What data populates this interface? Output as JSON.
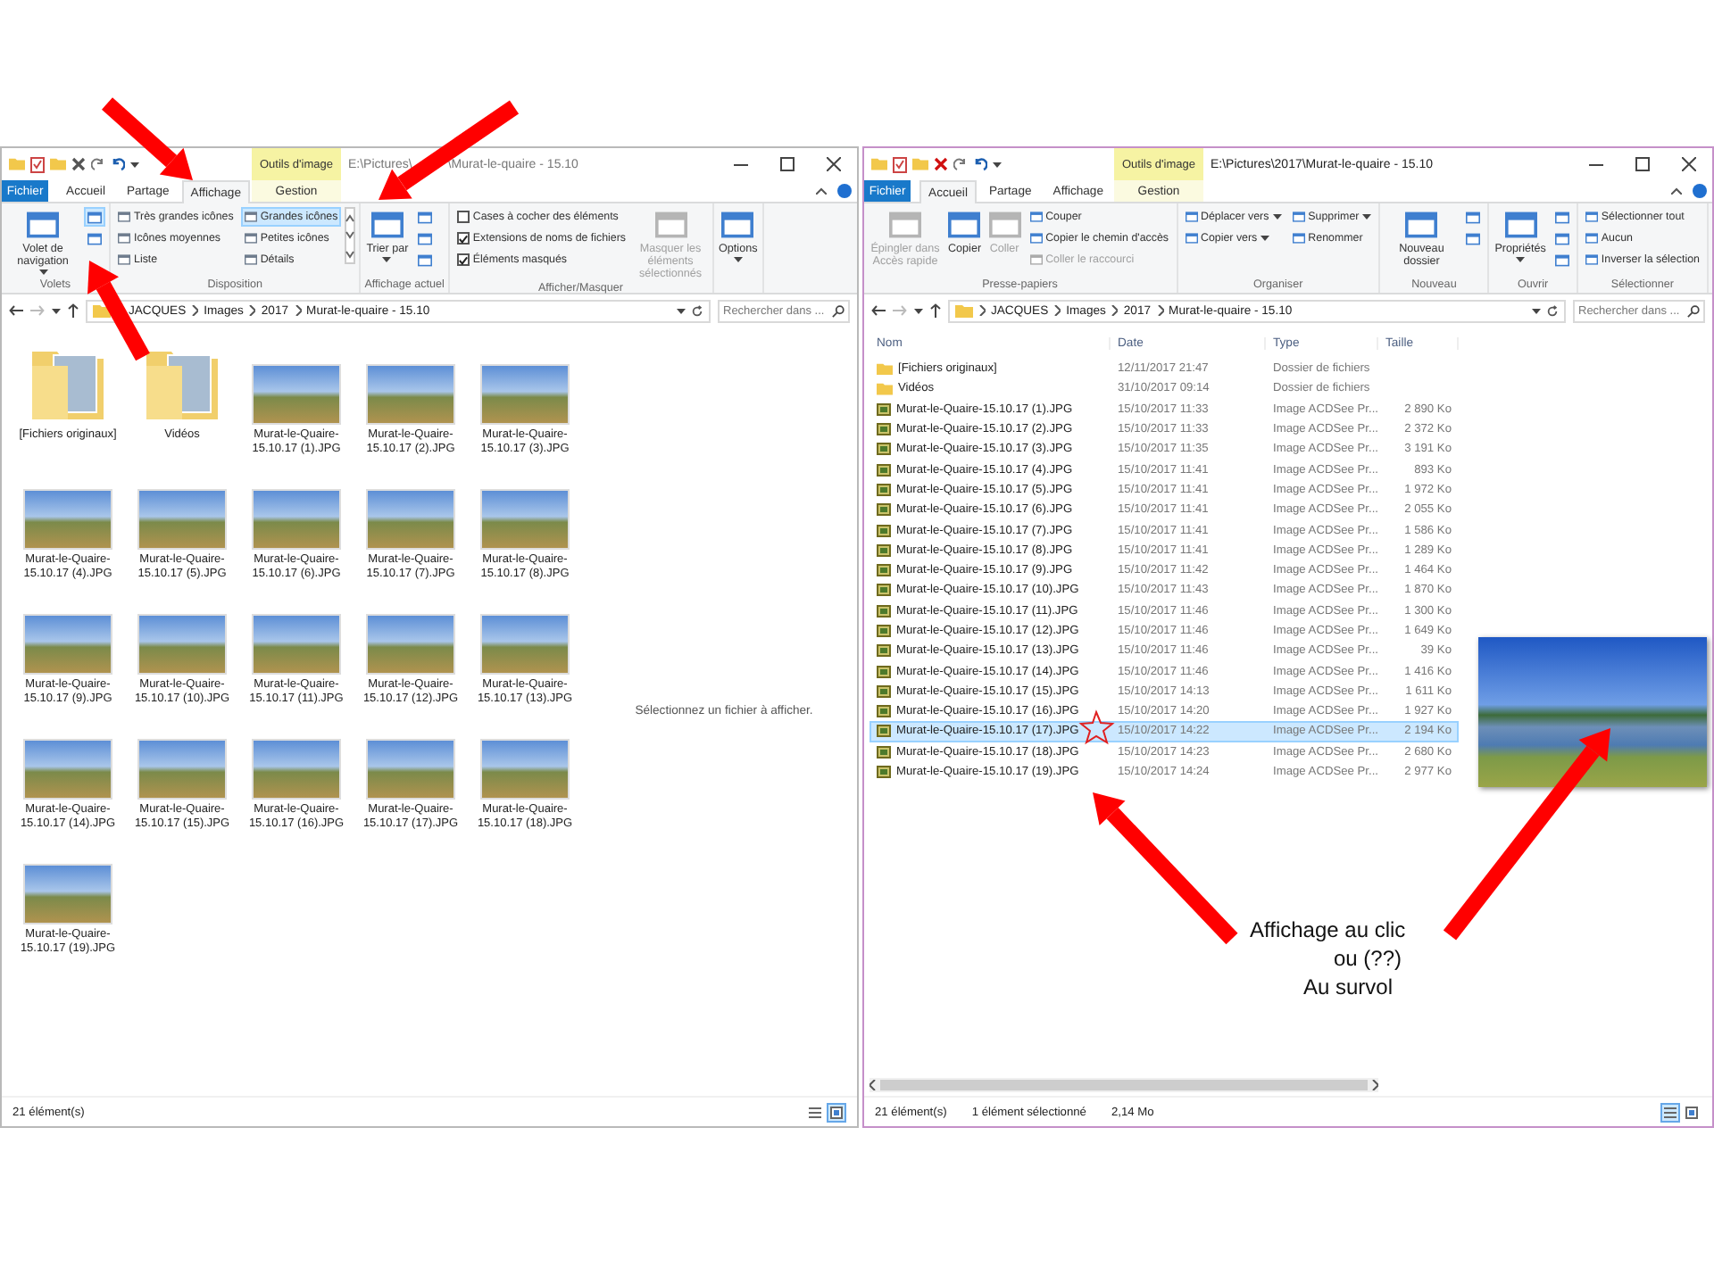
{
  "windows": [
    {
      "active": false,
      "title_bar": {
        "context_label": "Outils d'image",
        "path_parts": [
          "E:\\Pictures\\",
          "\\Murat-le-quaire - 15.10"
        ]
      },
      "tabs": [
        {
          "label": "Fichier",
          "kind": "file",
          "selected": false
        },
        {
          "label": "Accueil",
          "kind": "normal",
          "selected": false
        },
        {
          "label": "Partage",
          "kind": "normal",
          "selected": false
        },
        {
          "label": "Affichage",
          "kind": "normal",
          "selected": true
        },
        {
          "label": "Gestion",
          "kind": "context",
          "selected": false
        }
      ],
      "ribbon": [
        {
          "label": "Volets",
          "items": [
            {
              "kind": "large",
              "label": "Volet de navigation",
              "caret": true,
              "disabled": false
            },
            {
              "kind": "stack",
              "rows": [
                {
                  "kind": "icon",
                  "selected": true
                },
                {
                  "kind": "icon",
                  "selected": false
                }
              ]
            }
          ]
        },
        {
          "label": "Disposition",
          "items": [
            {
              "kind": "stack",
              "rows": [
                {
                  "kind": "option",
                  "label": "Très grandes icônes",
                  "selected": false
                },
                {
                  "kind": "option",
                  "label": "Icônes moyennes",
                  "selected": false
                },
                {
                  "kind": "option",
                  "label": "Liste",
                  "selected": false
                }
              ]
            },
            {
              "kind": "stack",
              "rows": [
                {
                  "kind": "option",
                  "label": "Grandes icônes",
                  "selected": true
                },
                {
                  "kind": "option",
                  "label": "Petites icônes",
                  "selected": false
                },
                {
                  "kind": "option",
                  "label": "Détails",
                  "selected": false
                }
              ]
            },
            {
              "kind": "scroll"
            }
          ]
        },
        {
          "label": "Affichage actuel",
          "items": [
            {
              "kind": "large",
              "label": "Trier par",
              "caret": true,
              "disabled": false
            },
            {
              "kind": "stack",
              "rows": [
                {
                  "kind": "icon",
                  "selected": false
                },
                {
                  "kind": "icon",
                  "selected": false
                },
                {
                  "kind": "icon",
                  "selected": false
                }
              ]
            }
          ]
        },
        {
          "label": "Afficher/Masquer",
          "items": [
            {
              "kind": "stack",
              "rows": [
                {
                  "kind": "check",
                  "label": "Cases à cocher des éléments",
                  "checked": false
                },
                {
                  "kind": "check",
                  "label": "Extensions de noms de fichiers",
                  "checked": true
                },
                {
                  "kind": "check",
                  "label": "Éléments masqués",
                  "checked": true
                }
              ]
            },
            {
              "kind": "large",
              "label": "Masquer les éléments sélectionnés",
              "caret": false,
              "disabled": true
            }
          ]
        },
        {
          "items": [
            {
              "kind": "large",
              "label": "Options",
              "caret": true,
              "disabled": false
            }
          ]
        }
      ],
      "address": {
        "crumbs": [
          "JACQUES",
          "Images",
          "2017",
          "Murat-le-quaire - 15.10"
        ],
        "search": {
          "placeholder": "Rechercher dans ..."
        }
      },
      "body": {
        "kind": "icons",
        "items": [
          {
            "kind": "folder",
            "name": "[Fichiers originaux]"
          },
          {
            "kind": "folder",
            "name": "Vidéos"
          },
          {
            "kind": "photo",
            "name": "Murat-le-Quaire-15.10.17 (1).JPG"
          },
          {
            "kind": "photo",
            "name": "Murat-le-Quaire-15.10.17 (2).JPG"
          },
          {
            "kind": "photo",
            "name": "Murat-le-Quaire-15.10.17 (3).JPG"
          },
          {
            "kind": "photo",
            "name": "Murat-le-Quaire-15.10.17 (4).JPG"
          },
          {
            "kind": "photo",
            "name": "Murat-le-Quaire-15.10.17 (5).JPG"
          },
          {
            "kind": "photo",
            "name": "Murat-le-Quaire-15.10.17 (6).JPG"
          },
          {
            "kind": "photo",
            "name": "Murat-le-Quaire-15.10.17 (7).JPG"
          },
          {
            "kind": "photo",
            "name": "Murat-le-Quaire-15.10.17 (8).JPG"
          },
          {
            "kind": "photo",
            "name": "Murat-le-Quaire-15.10.17 (9).JPG"
          },
          {
            "kind": "photo",
            "name": "Murat-le-Quaire-15.10.17 (10).JPG"
          },
          {
            "kind": "photo",
            "name": "Murat-le-Quaire-15.10.17 (11).JPG"
          },
          {
            "kind": "photo",
            "name": "Murat-le-Quaire-15.10.17 (12).JPG"
          },
          {
            "kind": "photo",
            "name": "Murat-le-Quaire-15.10.17 (13).JPG"
          },
          {
            "kind": "photo",
            "name": "Murat-le-Quaire-15.10.17 (14).JPG"
          },
          {
            "kind": "photo",
            "name": "Murat-le-Quaire-15.10.17 (15).JPG"
          },
          {
            "kind": "photo",
            "name": "Murat-le-Quaire-15.10.17 (16).JPG"
          },
          {
            "kind": "photo",
            "name": "Murat-le-Quaire-15.10.17 (17).JPG"
          },
          {
            "kind": "photo",
            "name": "Murat-le-Quaire-15.10.17 (18).JPG"
          },
          {
            "kind": "photo",
            "name": "Murat-le-Quaire-15.10.17 (19).JPG"
          }
        ],
        "preview": {
          "kind": "message",
          "text": "Sélectionnez un fichier à afficher."
        }
      },
      "status": {
        "count": "21 élément(s)",
        "views": [
          {
            "selected": false
          },
          {
            "selected": true
          }
        ]
      }
    },
    {
      "active": true,
      "title_bar": {
        "context_label": "Outils d'image",
        "path_parts": [
          "E:\\Pictures\\2017\\Murat-le-quaire - 15.10"
        ]
      },
      "tabs": [
        {
          "label": "Fichier",
          "kind": "file",
          "selected": false
        },
        {
          "label": "Accueil",
          "kind": "normal",
          "selected": true
        },
        {
          "label": "Partage",
          "kind": "normal",
          "selected": false
        },
        {
          "label": "Affichage",
          "kind": "normal",
          "selected": false
        },
        {
          "label": "Gestion",
          "kind": "context",
          "selected": false
        }
      ],
      "ribbon": [
        {
          "label": "Presse-papiers",
          "items": [
            {
              "kind": "large",
              "label": "Épingler dans Accès rapide",
              "caret": false,
              "disabled": true
            },
            {
              "kind": "large",
              "label": "Copier",
              "caret": false,
              "disabled": false
            },
            {
              "kind": "large",
              "label": "Coller",
              "caret": false,
              "disabled": true
            },
            {
              "kind": "stack",
              "rows": [
                {
                  "kind": "command",
                  "label": "Couper",
                  "caret": false,
                  "disabled": false
                },
                {
                  "kind": "command",
                  "label": "Copier le chemin d'accès",
                  "caret": false,
                  "disabled": false
                },
                {
                  "kind": "command",
                  "label": "Coller le raccourci",
                  "caret": false,
                  "disabled": true
                }
              ]
            }
          ]
        },
        {
          "label": "Organiser",
          "items": [
            {
              "kind": "stack",
              "rows": [
                {
                  "kind": "command",
                  "label": "Déplacer vers",
                  "caret": true,
                  "disabled": false
                },
                {
                  "kind": "command",
                  "label": "Copier vers",
                  "caret": true,
                  "disabled": false
                }
              ]
            },
            {
              "kind": "stack",
              "rows": [
                {
                  "kind": "command",
                  "label": "Supprimer",
                  "caret": true,
                  "disabled": false
                },
                {
                  "kind": "command",
                  "label": "Renommer",
                  "caret": false,
                  "disabled": false
                }
              ]
            }
          ]
        },
        {
          "label": "Nouveau",
          "items": [
            {
              "kind": "large",
              "label": "Nouveau dossier",
              "caret": false,
              "disabled": false
            },
            {
              "kind": "stack",
              "rows": [
                {
                  "kind": "icon",
                  "selected": false
                },
                {
                  "kind": "icon",
                  "selected": false
                }
              ]
            }
          ]
        },
        {
          "label": "Ouvrir",
          "items": [
            {
              "kind": "large",
              "label": "Propriétés",
              "caret": true,
              "disabled": false
            },
            {
              "kind": "stack",
              "rows": [
                {
                  "kind": "icon",
                  "selected": false
                },
                {
                  "kind": "icon",
                  "selected": false
                },
                {
                  "kind": "icon",
                  "selected": false
                }
              ]
            }
          ]
        },
        {
          "label": "Sélectionner",
          "items": [
            {
              "kind": "stack",
              "rows": [
                {
                  "kind": "command",
                  "label": "Sélectionner tout",
                  "caret": false,
                  "disabled": false
                },
                {
                  "kind": "command",
                  "label": "Aucun",
                  "caret": false,
                  "disabled": false
                },
                {
                  "kind": "command",
                  "label": "Inverser la sélection",
                  "caret": false,
                  "disabled": false
                }
              ]
            }
          ]
        }
      ],
      "address": {
        "crumbs": [
          "JACQUES",
          "Images",
          "2017",
          "Murat-le-quaire - 15.10"
        ],
        "search": {
          "placeholder": "Rechercher dans ..."
        }
      },
      "body": {
        "kind": "details",
        "columns": [
          "Nom",
          "Date",
          "Type",
          "Taille"
        ],
        "rows": [
          {
            "kind": "folder",
            "name": "[Fichiers originaux]",
            "date": "12/11/2017 21:47",
            "type": "Dossier de fichiers",
            "size": "",
            "selected": false
          },
          {
            "kind": "folder",
            "name": "Vidéos",
            "date": "31/10/2017 09:14",
            "type": "Dossier de fichiers",
            "size": "",
            "selected": false
          },
          {
            "kind": "photo",
            "name": "Murat-le-Quaire-15.10.17 (1).JPG",
            "date": "15/10/2017 11:33",
            "type": "Image ACDSee Pr...",
            "size": "2 890 Ko",
            "selected": false
          },
          {
            "kind": "photo",
            "name": "Murat-le-Quaire-15.10.17 (2).JPG",
            "date": "15/10/2017 11:33",
            "type": "Image ACDSee Pr...",
            "size": "2 372 Ko",
            "selected": false
          },
          {
            "kind": "photo",
            "name": "Murat-le-Quaire-15.10.17 (3).JPG",
            "date": "15/10/2017 11:35",
            "type": "Image ACDSee Pr...",
            "size": "3 191 Ko",
            "selected": false
          },
          {
            "kind": "photo",
            "name": "Murat-le-Quaire-15.10.17 (4).JPG",
            "date": "15/10/2017 11:41",
            "type": "Image ACDSee Pr...",
            "size": "893 Ko",
            "selected": false
          },
          {
            "kind": "photo",
            "name": "Murat-le-Quaire-15.10.17 (5).JPG",
            "date": "15/10/2017 11:41",
            "type": "Image ACDSee Pr...",
            "size": "1 972 Ko",
            "selected": false
          },
          {
            "kind": "photo",
            "name": "Murat-le-Quaire-15.10.17 (6).JPG",
            "date": "15/10/2017 11:41",
            "type": "Image ACDSee Pr...",
            "size": "2 055 Ko",
            "selected": false
          },
          {
            "kind": "photo",
            "name": "Murat-le-Quaire-15.10.17 (7).JPG",
            "date": "15/10/2017 11:41",
            "type": "Image ACDSee Pr...",
            "size": "1 586 Ko",
            "selected": false
          },
          {
            "kind": "photo",
            "name": "Murat-le-Quaire-15.10.17 (8).JPG",
            "date": "15/10/2017 11:41",
            "type": "Image ACDSee Pr...",
            "size": "1 289 Ko",
            "selected": false
          },
          {
            "kind": "photo",
            "name": "Murat-le-Quaire-15.10.17 (9).JPG",
            "date": "15/10/2017 11:42",
            "type": "Image ACDSee Pr...",
            "size": "1 464 Ko",
            "selected": false
          },
          {
            "kind": "photo",
            "name": "Murat-le-Quaire-15.10.17 (10).JPG",
            "date": "15/10/2017 11:43",
            "type": "Image ACDSee Pr...",
            "size": "1 870 Ko",
            "selected": false
          },
          {
            "kind": "photo",
            "name": "Murat-le-Quaire-15.10.17 (11).JPG",
            "date": "15/10/2017 11:46",
            "type": "Image ACDSee Pr...",
            "size": "1 300 Ko",
            "selected": false
          },
          {
            "kind": "photo",
            "name": "Murat-le-Quaire-15.10.17 (12).JPG",
            "date": "15/10/2017 11:46",
            "type": "Image ACDSee Pr...",
            "size": "1 649 Ko",
            "selected": false
          },
          {
            "kind": "photo",
            "name": "Murat-le-Quaire-15.10.17 (13).JPG",
            "date": "15/10/2017 11:46",
            "type": "Image ACDSee Pr...",
            "size": "39 Ko",
            "selected": false
          },
          {
            "kind": "photo",
            "name": "Murat-le-Quaire-15.10.17 (14).JPG",
            "date": "15/10/2017 11:46",
            "type": "Image ACDSee Pr...",
            "size": "1 416 Ko",
            "selected": false
          },
          {
            "kind": "photo",
            "name": "Murat-le-Quaire-15.10.17 (15).JPG",
            "date": "15/10/2017 14:13",
            "type": "Image ACDSee Pr...",
            "size": "1 611 Ko",
            "selected": false
          },
          {
            "kind": "photo",
            "name": "Murat-le-Quaire-15.10.17 (16).JPG",
            "date": "15/10/2017 14:20",
            "type": "Image ACDSee Pr...",
            "size": "1 927 Ko",
            "selected": false
          },
          {
            "kind": "photo",
            "name": "Murat-le-Quaire-15.10.17 (17).JPG",
            "date": "15/10/2017 14:22",
            "type": "Image ACDSee Pr...",
            "size": "2 194 Ko",
            "selected": true
          },
          {
            "kind": "photo",
            "name": "Murat-le-Quaire-15.10.17 (18).JPG",
            "date": "15/10/2017 14:23",
            "type": "Image ACDSee Pr...",
            "size": "2 680 Ko",
            "selected": false
          },
          {
            "kind": "photo",
            "name": "Murat-le-Quaire-15.10.17 (19).JPG",
            "date": "15/10/2017 14:24",
            "type": "Image ACDSee Pr...",
            "size": "2 977 Ko",
            "selected": false
          }
        ],
        "preview": {
          "kind": "image"
        }
      },
      "status": {
        "count": "21 élément(s)",
        "selection": "1 élément sélectionné",
        "size": "2,14 Mo",
        "views": [
          {
            "selected": true
          },
          {
            "selected": false
          }
        ]
      }
    }
  ],
  "annotation": {
    "lines": [
      "Affichage au clic",
      "ou (??)",
      "Au survol"
    ]
  }
}
